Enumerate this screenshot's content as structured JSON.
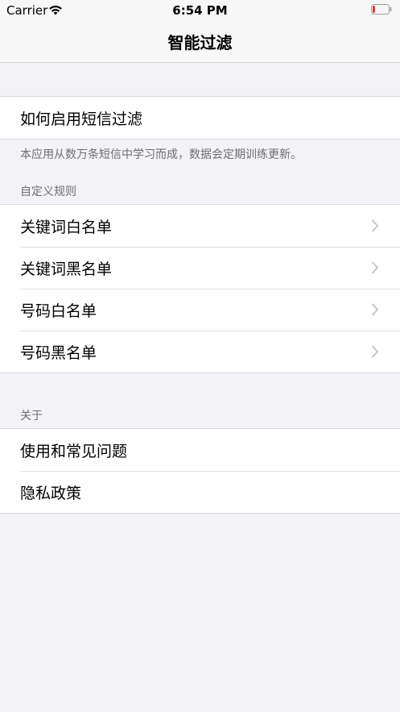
{
  "status_bar": {
    "carrier": "Carrier",
    "time": "6:54 PM",
    "battery_level": 0.15,
    "battery_color": "#e5322d"
  },
  "nav": {
    "title": "智能过滤"
  },
  "section_enable": {
    "item": "如何启用短信过滤",
    "footer": "本应用从数万条短信中学习而成，数据会定期训练更新。"
  },
  "section_rules": {
    "header": "自定义规则",
    "items": [
      {
        "label": "关键词白名单",
        "icon": "chevron-right-icon"
      },
      {
        "label": "关键词黑名单",
        "icon": "chevron-right-icon"
      },
      {
        "label": "号码白名单",
        "icon": "chevron-right-icon"
      },
      {
        "label": "号码黑名单",
        "icon": "chevron-right-icon"
      }
    ]
  },
  "section_about": {
    "header": "关于",
    "items": [
      {
        "label": "使用和常见问题"
      },
      {
        "label": "隐私政策"
      }
    ]
  },
  "colors": {
    "background": "#f2f2f7",
    "cell": "#ffffff",
    "secondary_text": "#6d6d72",
    "chevron": "#c4c4c8"
  }
}
